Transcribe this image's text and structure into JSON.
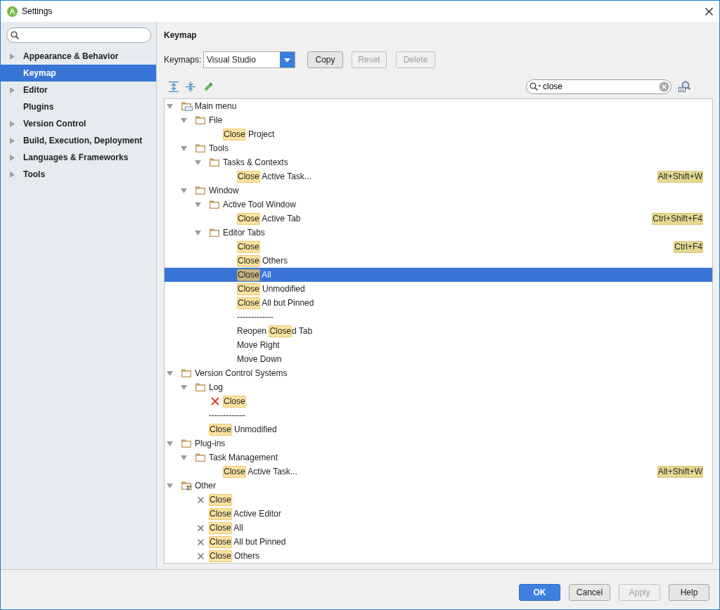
{
  "window": {
    "title": "Settings"
  },
  "sidebar": {
    "items": [
      {
        "label": "Appearance & Behavior",
        "has_children": true,
        "selected": false
      },
      {
        "label": "Keymap",
        "has_children": false,
        "selected": true
      },
      {
        "label": "Editor",
        "has_children": true,
        "selected": false
      },
      {
        "label": "Plugins",
        "has_children": false,
        "selected": false
      },
      {
        "label": "Version Control",
        "has_children": true,
        "selected": false
      },
      {
        "label": "Build, Execution, Deployment",
        "has_children": true,
        "selected": false
      },
      {
        "label": "Languages & Frameworks",
        "has_children": true,
        "selected": false
      },
      {
        "label": "Tools",
        "has_children": true,
        "selected": false
      }
    ]
  },
  "keymap": {
    "title": "Keymap",
    "keymaps_label": "Keymaps:",
    "keymap_select": {
      "value": "Visual Studio"
    },
    "buttons": [
      {
        "label": "Copy",
        "disabled": false
      },
      {
        "label": "Reset",
        "disabled": true
      },
      {
        "label": "Delete",
        "disabled": true
      }
    ],
    "filter": {
      "value": "close"
    },
    "tree": [
      {
        "kind": "menu",
        "label": "Main menu",
        "expanded": true,
        "selected": false,
        "children": [
          {
            "kind": "folder",
            "label": "File",
            "expanded": true,
            "selected": false,
            "children": [
              {
                "kind": "action",
                "parts": [
                  {
                    "text": "Close",
                    "highlighted": true
                  },
                  {
                    "text": " Project",
                    "highlighted": false
                  }
                ],
                "selected": false
              }
            ]
          },
          {
            "kind": "folder",
            "label": "Tools",
            "expanded": true,
            "selected": false,
            "children": [
              {
                "kind": "folder",
                "label": "Tasks & Contexts",
                "expanded": true,
                "selected": false,
                "children": [
                  {
                    "kind": "action",
                    "parts": [
                      {
                        "text": "Close",
                        "highlighted": true
                      },
                      {
                        "text": " Active Task...",
                        "highlighted": false
                      }
                    ],
                    "shortcut": "Alt+Shift+W",
                    "selected": false
                  }
                ]
              }
            ]
          },
          {
            "kind": "folder",
            "label": "Window",
            "expanded": true,
            "selected": false,
            "children": [
              {
                "kind": "folder",
                "label": "Active Tool Window",
                "expanded": true,
                "selected": false,
                "children": [
                  {
                    "kind": "action",
                    "parts": [
                      {
                        "text": "Close",
                        "highlighted": true
                      },
                      {
                        "text": " Active Tab",
                        "highlighted": false
                      }
                    ],
                    "shortcut": "Ctrl+Shift+F4",
                    "selected": false
                  }
                ]
              },
              {
                "kind": "folder",
                "label": "Editor Tabs",
                "expanded": true,
                "selected": false,
                "children": [
                  {
                    "kind": "action",
                    "parts": [
                      {
                        "text": "Close",
                        "highlighted": true
                      }
                    ],
                    "shortcut": "Ctrl+F4",
                    "selected": false
                  },
                  {
                    "kind": "action",
                    "parts": [
                      {
                        "text": "Close",
                        "highlighted": true
                      },
                      {
                        "text": " Others",
                        "highlighted": false
                      }
                    ],
                    "selected": false
                  },
                  {
                    "kind": "action",
                    "parts": [
                      {
                        "text": "Close",
                        "highlighted": true
                      },
                      {
                        "text": " All",
                        "highlighted": false
                      }
                    ],
                    "selected": true
                  },
                  {
                    "kind": "action",
                    "parts": [
                      {
                        "text": "Close",
                        "highlighted": true
                      },
                      {
                        "text": " Unmodified",
                        "highlighted": false
                      }
                    ],
                    "selected": false
                  },
                  {
                    "kind": "action",
                    "parts": [
                      {
                        "text": "Close",
                        "highlighted": true
                      },
                      {
                        "text": " All but Pinned",
                        "highlighted": false
                      }
                    ],
                    "selected": false
                  },
                  {
                    "kind": "separator",
                    "label": "-------------",
                    "selected": false
                  },
                  {
                    "kind": "action",
                    "parts": [
                      {
                        "text": "Reopen ",
                        "highlighted": false
                      },
                      {
                        "text": "Close",
                        "highlighted": true
                      },
                      {
                        "text": "d Tab",
                        "highlighted": false
                      }
                    ],
                    "selected": false
                  },
                  {
                    "kind": "action",
                    "parts": [
                      {
                        "text": "Move Right",
                        "highlighted": false
                      }
                    ],
                    "selected": false
                  },
                  {
                    "kind": "action",
                    "parts": [
                      {
                        "text": "Move Down",
                        "highlighted": false
                      }
                    ],
                    "selected": false
                  }
                ]
              }
            ]
          }
        ]
      },
      {
        "kind": "folder",
        "label": "Version Control Systems",
        "expanded": true,
        "selected": false,
        "children": [
          {
            "kind": "folder",
            "label": "Log",
            "expanded": true,
            "selected": false,
            "children": [
              {
                "kind": "cancel",
                "parts": [
                  {
                    "text": "Close",
                    "highlighted": true
                  }
                ],
                "selected": false
              }
            ]
          },
          {
            "kind": "separator",
            "label": "-------------",
            "selected": false
          },
          {
            "kind": "action",
            "parts": [
              {
                "text": "Close",
                "highlighted": true
              },
              {
                "text": " Unmodified",
                "highlighted": false
              }
            ],
            "selected": false
          }
        ]
      },
      {
        "kind": "folder",
        "label": "Plug-ins",
        "expanded": true,
        "selected": false,
        "children": [
          {
            "kind": "folder",
            "label": "Task Management",
            "expanded": true,
            "selected": false,
            "children": [
              {
                "kind": "action",
                "parts": [
                  {
                    "text": "Close",
                    "highlighted": true
                  },
                  {
                    "text": " Active Task...",
                    "highlighted": false
                  }
                ],
                "shortcut": "Alt+Shift+W",
                "selected": false
              }
            ]
          }
        ]
      },
      {
        "kind": "misc",
        "label": "Other",
        "expanded": true,
        "selected": false,
        "children": [
          {
            "kind": "close",
            "parts": [
              {
                "text": "Close",
                "highlighted": true
              }
            ],
            "selected": false
          },
          {
            "kind": "action",
            "parts": [
              {
                "text": "Close",
                "highlighted": true
              },
              {
                "text": " Active Editor",
                "highlighted": false
              }
            ],
            "selected": false
          },
          {
            "kind": "close",
            "parts": [
              {
                "text": "Close",
                "highlighted": true
              },
              {
                "text": " All",
                "highlighted": false
              }
            ],
            "selected": false
          },
          {
            "kind": "close",
            "parts": [
              {
                "text": "Close",
                "highlighted": true
              },
              {
                "text": " All but Pinned",
                "highlighted": false
              }
            ],
            "selected": false
          },
          {
            "kind": "close",
            "parts": [
              {
                "text": "Close",
                "highlighted": true
              },
              {
                "text": " Others",
                "highlighted": false
              }
            ],
            "selected": false
          }
        ]
      }
    ]
  },
  "footer": {
    "buttons": [
      {
        "label": "OK",
        "kind": "primary",
        "disabled": false
      },
      {
        "label": "Cancel",
        "kind": "default",
        "disabled": false
      },
      {
        "label": "Apply",
        "kind": "default",
        "disabled": true
      },
      {
        "label": "Help",
        "kind": "default",
        "disabled": false
      }
    ]
  }
}
